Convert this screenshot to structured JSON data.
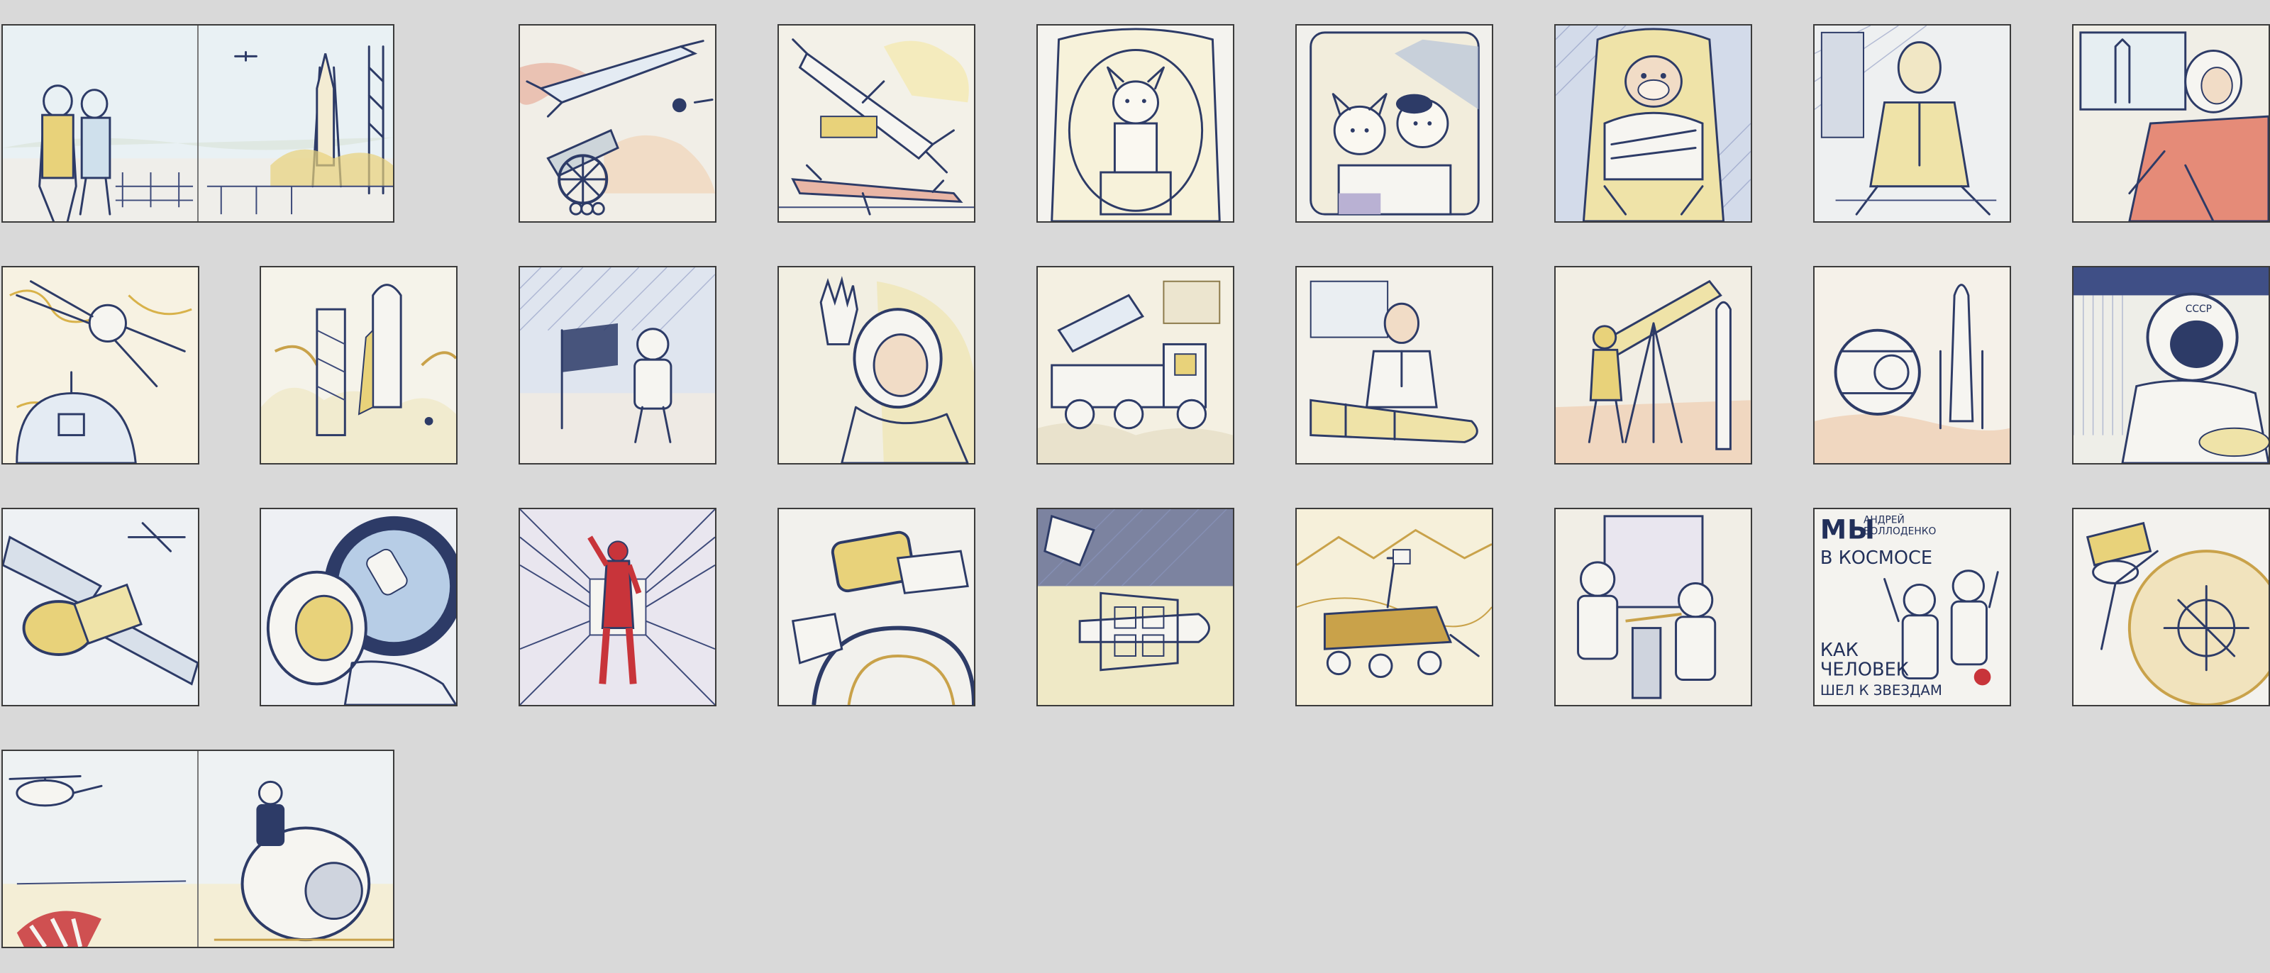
{
  "page": {
    "background": "#d9d9d9"
  },
  "palette": {
    "ink": "#2d3b67",
    "yellow": "#e8d27a",
    "ochre": "#c9a24a",
    "sky": "#cfe0ec",
    "red": "#c8343a",
    "pink": "#e9b6a6",
    "paper": "#f6f5f1"
  },
  "thumbnails": [
    {
      "id": "spread-cosmonauts-launchpad",
      "icon": "rocket-launchpad-icon"
    },
    {
      "id": "rocket-and-cannon",
      "icon": "cannon-icon"
    },
    {
      "id": "v2-rocket-and-plane",
      "icon": "rocket-icon"
    },
    {
      "id": "dog-in-capsule",
      "icon": "dog-icon"
    },
    {
      "id": "two-dogs-in-capsule",
      "icon": "dog-icon"
    },
    {
      "id": "monkey-in-seat",
      "icon": "monkey-icon"
    },
    {
      "id": "cosmonaut-sitting",
      "icon": "cosmonaut-icon"
    },
    {
      "id": "cosmonaut-red-suit",
      "icon": "cosmonaut-icon"
    },
    {
      "id": "sputnik-and-capsule",
      "icon": "satellite-icon"
    },
    {
      "id": "shuttle-on-pad",
      "icon": "shuttle-icon"
    },
    {
      "id": "moonwalk-flag",
      "icon": "astronaut-icon"
    },
    {
      "id": "waving-cosmonaut",
      "icon": "cosmonaut-icon"
    },
    {
      "id": "katyusha-truck",
      "icon": "truck-icon"
    },
    {
      "id": "engineer-with-rocket",
      "icon": "engineer-icon"
    },
    {
      "id": "soldier-with-telescope",
      "icon": "telescope-icon"
    },
    {
      "id": "vostok-capsule-and-rocket",
      "icon": "capsule-icon"
    },
    {
      "id": "cosmonaut-helmet-sssr",
      "icon": "helmet-icon"
    },
    {
      "id": "space-station-panels",
      "icon": "station-icon"
    },
    {
      "id": "cosmonaut-at-porthole",
      "icon": "porthole-icon"
    },
    {
      "id": "astronaut-in-corridor",
      "icon": "astronaut-icon"
    },
    {
      "id": "hands-on-controls",
      "icon": "controls-icon"
    },
    {
      "id": "shuttle-and-stack",
      "icon": "shuttle-icon"
    },
    {
      "id": "mars-rover",
      "icon": "rover-icon"
    },
    {
      "id": "astronauts-at-door",
      "icon": "astronaut-icon"
    },
    {
      "id": "book-cover",
      "icon": "cover-icon"
    },
    {
      "id": "voyager-golden-record",
      "icon": "probe-icon"
    },
    {
      "id": "spread-capsule-landing",
      "icon": "landing-icon"
    }
  ],
  "cover": {
    "title_line1": "МЫ",
    "title_line2": "В КОСМОСЕ",
    "author_line1": "АНДРЕЙ",
    "author_line2": "ВОЛЛОДЕНКО",
    "subtitle_line1": "КАК",
    "subtitle_line2": "ЧЕЛОВЕК",
    "subtitle_line3": "ШЕЛ К ЗВЕЗДАМ"
  },
  "helmet_label": "СССР"
}
